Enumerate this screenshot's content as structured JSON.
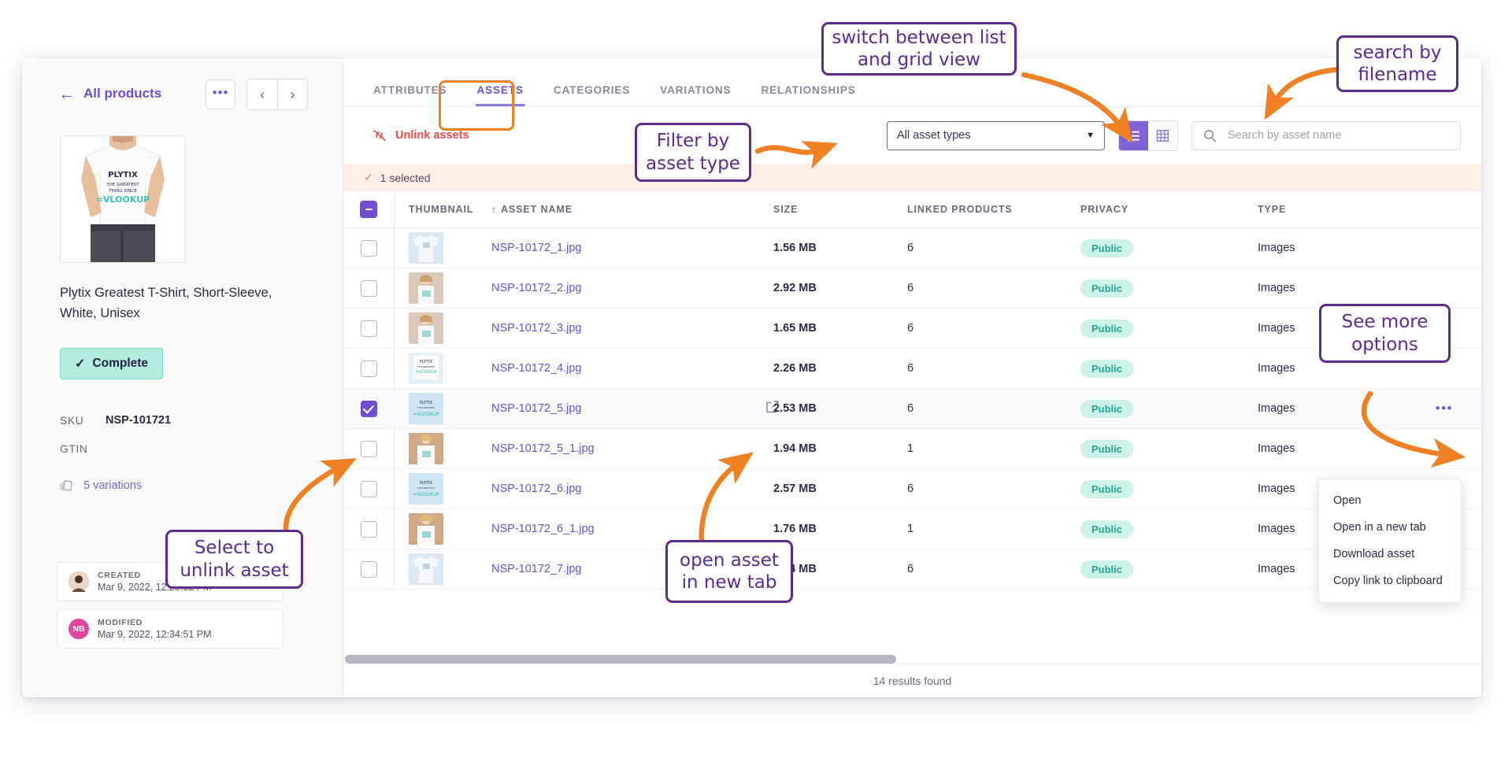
{
  "product_panel": {
    "back_label": "All products",
    "more_button": "•••",
    "prev_button": "‹",
    "next_button": "›",
    "title": "Plytix Greatest T-Shirt, Short-Sleeve, White, Unisex",
    "status_label": "Complete",
    "status_check": "✓",
    "sku_label": "SKU",
    "sku_value": "NSP-101721",
    "gtin_label": "GTIN",
    "gtin_value": "",
    "variations_label": "5 variations",
    "created": {
      "label": "CREATED",
      "date": "Mar 9, 2022, 12:28:32 PM",
      "avatar_initials": "",
      "avatar_color": "#c8a08a"
    },
    "modified": {
      "label": "MODIFIED",
      "date": "Mar 9, 2022, 12:34:51 PM",
      "avatar_initials": "NB",
      "avatar_color": "#e0469f"
    }
  },
  "tabs": [
    {
      "label": "ATTRIBUTES",
      "active": false
    },
    {
      "label": "ASSETS",
      "active": true
    },
    {
      "label": "CATEGORIES",
      "active": false
    },
    {
      "label": "VARIATIONS",
      "active": false
    },
    {
      "label": "RELATIONSHIPS",
      "active": false
    }
  ],
  "toolbar": {
    "unlink_label": "Unlink assets",
    "asset_type_value": "All asset types",
    "search_placeholder": "Search by asset name",
    "search_value": ""
  },
  "selection": {
    "label": "1 selected",
    "check": "✓"
  },
  "table": {
    "headers": [
      "THUMBNAIL",
      "ASSET NAME",
      "SIZE",
      "LINKED PRODUCTS",
      "PRIVACY",
      "TYPE"
    ],
    "sort_column": "ASSET NAME",
    "sort_direction": "↑",
    "rows": [
      {
        "name": "NSP-10172_1.jpg",
        "size": "1.56 MB",
        "linked": "6",
        "privacy": "Public",
        "type": "Images",
        "selected": false,
        "thumb": "a"
      },
      {
        "name": "NSP-10172_2.jpg",
        "size": "2.92 MB",
        "linked": "6",
        "privacy": "Public",
        "type": "Images",
        "selected": false,
        "thumb": "b"
      },
      {
        "name": "NSP-10172_3.jpg",
        "size": "1.65 MB",
        "linked": "6",
        "privacy": "Public",
        "type": "Images",
        "selected": false,
        "thumb": "b"
      },
      {
        "name": "NSP-10172_4.jpg",
        "size": "2.26 MB",
        "linked": "6",
        "privacy": "Public",
        "type": "Images",
        "selected": false,
        "thumb": "c"
      },
      {
        "name": "NSP-10172_5.jpg",
        "size": "2.53 MB",
        "linked": "6",
        "privacy": "Public",
        "type": "Images",
        "selected": true,
        "thumb": "d"
      },
      {
        "name": "NSP-10172_5_1.jpg",
        "size": "1.94 MB",
        "linked": "1",
        "privacy": "Public",
        "type": "Images",
        "selected": false,
        "thumb": "e"
      },
      {
        "name": "NSP-10172_6.jpg",
        "size": "2.57 MB",
        "linked": "6",
        "privacy": "Public",
        "type": "Images",
        "selected": false,
        "thumb": "d"
      },
      {
        "name": "NSP-10172_6_1.jpg",
        "size": "1.76 MB",
        "linked": "1",
        "privacy": "Public",
        "type": "Images",
        "selected": false,
        "thumb": "e"
      },
      {
        "name": "NSP-10172_7.jpg",
        "size": "2.54 MB",
        "linked": "6",
        "privacy": "Public",
        "type": "Images",
        "selected": false,
        "thumb": "a"
      }
    ]
  },
  "footer": {
    "results_text": "14 results found"
  },
  "context_menu": {
    "items": [
      "Open",
      "Open in a new tab",
      "Download asset",
      "Copy link to clipboard"
    ]
  },
  "annotations": {
    "switch_view": "switch between list and grid view",
    "search_by_filename": "search by filename",
    "filter_by_asset_type": "Filter by asset type",
    "see_more_options": "See more options",
    "select_to_unlink": "Select to unlink asset",
    "open_in_new_tab": "open asset in new tab"
  },
  "colors": {
    "purple": "#6f4fd0",
    "orange": "#ef8023",
    "annotation_purple": "#5b2b8e",
    "red": "#ef4b4b",
    "teal": "#2aa58f",
    "selected_bar": "#fdeee6"
  }
}
